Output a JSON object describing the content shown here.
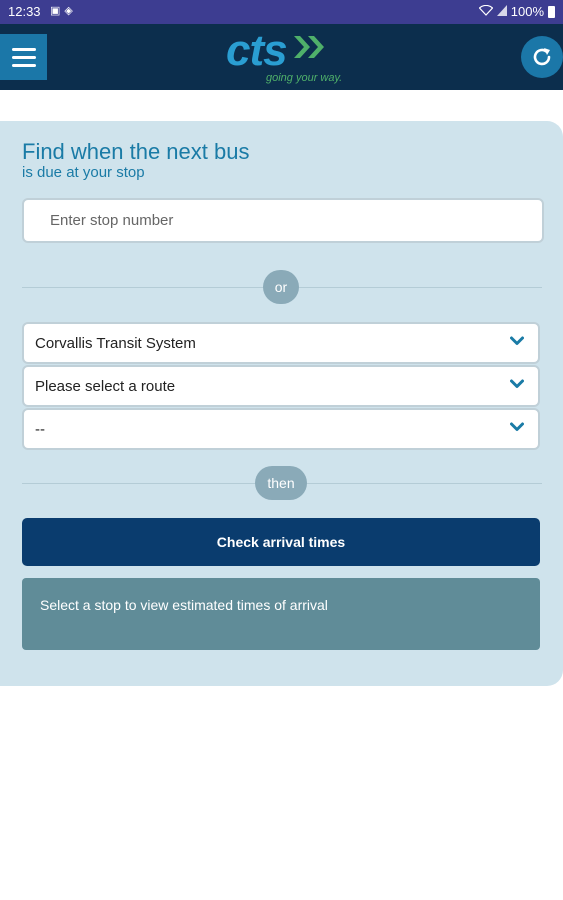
{
  "status_bar": {
    "time": "12:33",
    "battery": "100%",
    "left_icons": [
      "image-icon",
      "shield-icon"
    ],
    "right_icons": [
      "wifi-icon",
      "signal-icon",
      "battery-icon"
    ]
  },
  "header": {
    "menu_icon": "hamburger-icon",
    "logo_text": "cts",
    "tagline": "going your way.",
    "refresh_icon": "refresh-icon",
    "background": "#0c2e4d",
    "accent": "#1b77a8"
  },
  "finder": {
    "title": "Find when the next bus",
    "subtitle": "is due at your stop",
    "stop_placeholder": "Enter stop number",
    "stop_value": "",
    "or_label": "or",
    "agency_select": "Corvallis Transit System",
    "route_select": "Please select a route",
    "stop_select": "--",
    "then_label": "then",
    "check_button": "Check arrival times",
    "info_text": "Select a stop to view estimated times of arrival"
  },
  "colors": {
    "panel_bg": "#cfe3ec",
    "title_color": "#1a7ba6",
    "button_bg": "#0a3c6e",
    "info_bg": "#608c98"
  }
}
